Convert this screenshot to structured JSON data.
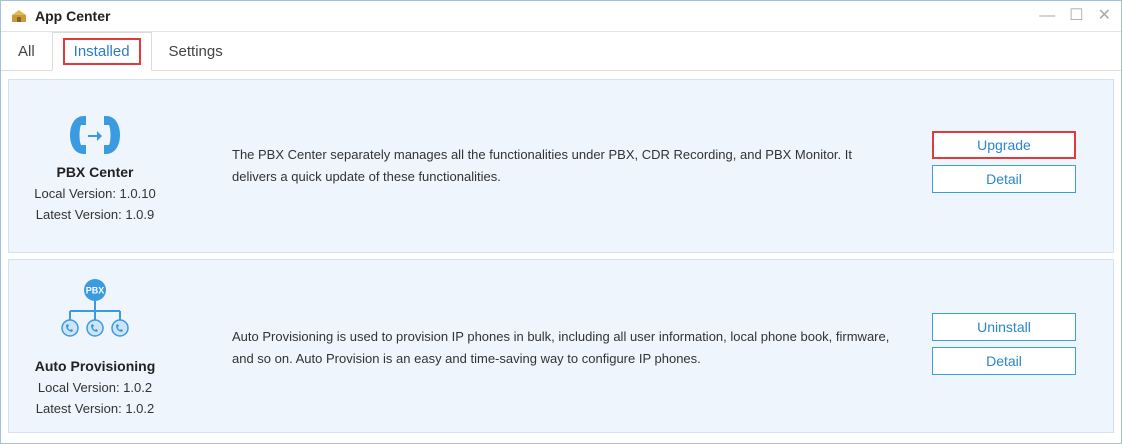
{
  "window": {
    "title": "App Center",
    "controls": {
      "minimize": "—",
      "maximize": "☐",
      "close": "✕"
    }
  },
  "tabs": [
    {
      "label": "All"
    },
    {
      "label": "Installed",
      "active": true
    },
    {
      "label": "Settings"
    }
  ],
  "apps": [
    {
      "name": "PBX Center",
      "local_version": "Local Version: 1.0.10",
      "latest_version": "Latest Version: 1.0.9",
      "description": "The PBX Center separately manages all the functionalities under PBX, CDR Recording, and PBX Monitor. It delivers a quick update of these functionalities.",
      "primary_button": "Upgrade",
      "detail_button": "Detail",
      "icon": "phone-transfer-icon"
    },
    {
      "name": "Auto Provisioning",
      "local_version": "Local Version: 1.0.2",
      "latest_version": "Latest Version: 1.0.2",
      "description": "Auto Provisioning is used to provision IP phones in bulk, including all user information, local phone book, firmware, and so on. Auto Provision is an easy and time-saving way to configure IP phones.",
      "primary_button": "Uninstall",
      "detail_button": "Detail",
      "icon": "pbx-network-icon",
      "icon_text": "PBX"
    }
  ],
  "colors": {
    "accent": "#2a86c9",
    "highlight": "#e23a3a",
    "card_bg": "#eef5fc",
    "phone_blue": "#3a9be0"
  }
}
